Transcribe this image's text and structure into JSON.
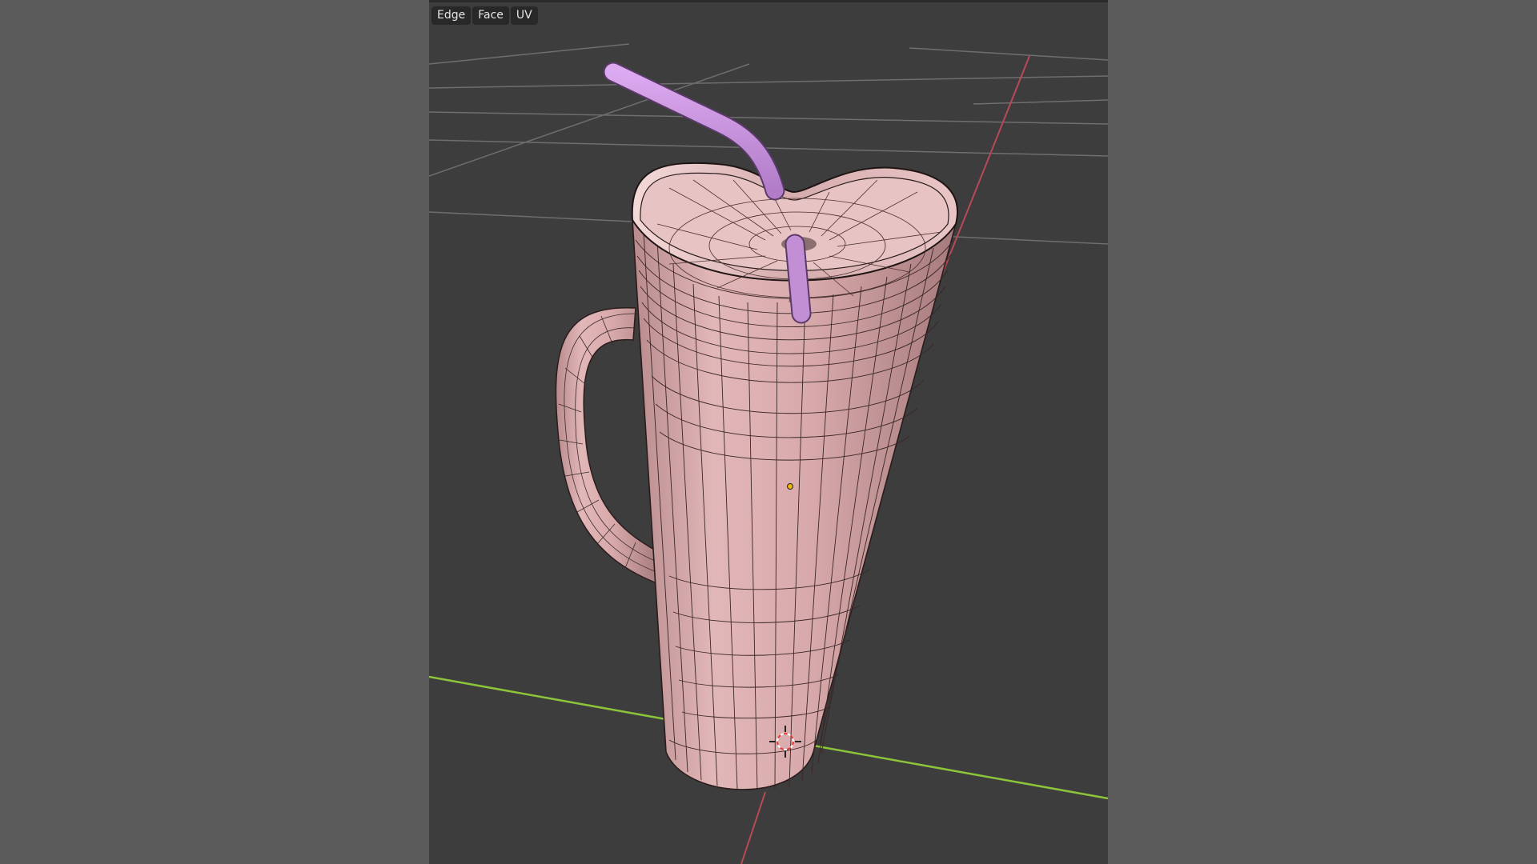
{
  "menu": {
    "items": [
      "Edge",
      "Face",
      "UV"
    ]
  },
  "colors": {
    "background": "#5a5a5a",
    "viewport": "#3d3d3d",
    "mesh_surface": "#d8a8aa",
    "straw": "#c28fd4",
    "x_axis": "#b74a55",
    "y_axis": "#8cc43a"
  },
  "icons": {
    "cursor": "3d-cursor-icon",
    "origin": "object-origin-icon"
  }
}
